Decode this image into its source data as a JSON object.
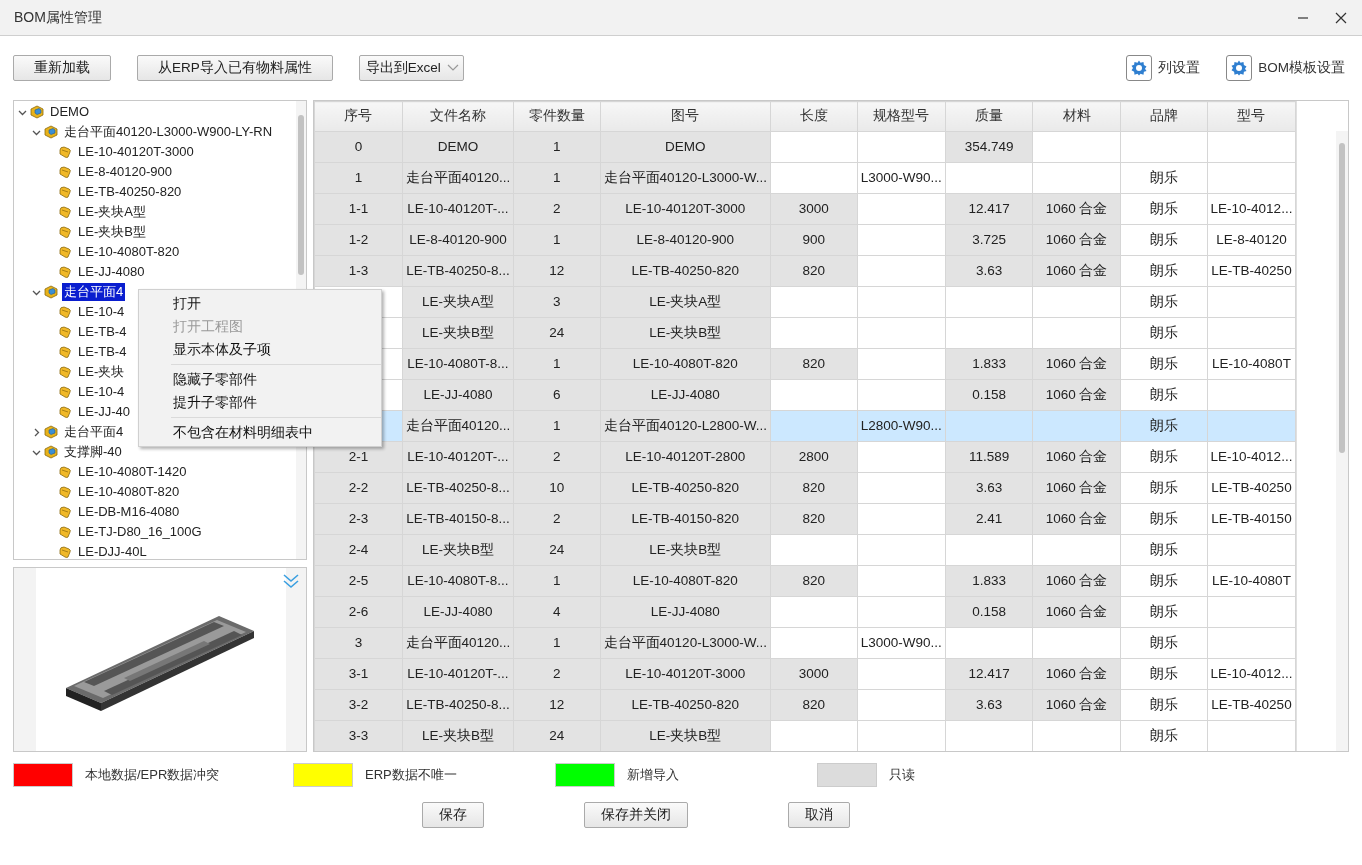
{
  "window": {
    "title": "BOM属性管理"
  },
  "toolbar": {
    "buttons": [
      "重新加载",
      "从ERP导入已有物料属性"
    ],
    "export_dropdown": "导出到Excel",
    "settings": [
      "列设置",
      "BOM模板设置"
    ]
  },
  "tree": [
    {
      "label": "DEMO",
      "kind": "assembly",
      "expanded": true,
      "selected": false,
      "children": [
        {
          "label": "走台平面40120-L3000-W900-LY-RN",
          "kind": "assembly",
          "expanded": true,
          "selected": false,
          "children": [
            {
              "label": "LE-10-40120T-3000",
              "kind": "part",
              "selected": false
            },
            {
              "label": "LE-8-40120-900",
              "kind": "part",
              "selected": false
            },
            {
              "label": "LE-TB-40250-820",
              "kind": "part",
              "selected": false
            },
            {
              "label": "LE-夹块A型",
              "kind": "part",
              "selected": false
            },
            {
              "label": "LE-夹块B型",
              "kind": "part",
              "selected": false
            },
            {
              "label": "LE-10-4080T-820",
              "kind": "part",
              "selected": false
            },
            {
              "label": "LE-JJ-4080",
              "kind": "part",
              "selected": false
            }
          ]
        },
        {
          "label": "走台平面4",
          "kind": "assembly",
          "expanded": true,
          "selected": true,
          "children": [
            {
              "label": "LE-10-4",
              "kind": "part",
              "selected": false
            },
            {
              "label": "LE-TB-4",
              "kind": "part",
              "selected": false
            },
            {
              "label": "LE-TB-4",
              "kind": "part",
              "selected": false
            },
            {
              "label": "LE-夹块",
              "kind": "part",
              "selected": false
            },
            {
              "label": "LE-10-4",
              "kind": "part",
              "selected": false
            },
            {
              "label": "LE-JJ-40",
              "kind": "part",
              "selected": false
            }
          ]
        },
        {
          "label": "走台平面4",
          "kind": "assembly",
          "expanded": false,
          "selected": false
        },
        {
          "label": "支撑脚-40",
          "kind": "assembly",
          "expanded": true,
          "selected": false,
          "children": [
            {
              "label": "LE-10-4080T-1420",
              "kind": "part",
              "selected": false
            },
            {
              "label": "LE-10-4080T-820",
              "kind": "part",
              "selected": false
            },
            {
              "label": "LE-DB-M16-4080",
              "kind": "part",
              "selected": false
            },
            {
              "label": "LE-TJ-D80_16_100G",
              "kind": "part",
              "selected": false
            },
            {
              "label": "LE-DJJ-40L",
              "kind": "part",
              "selected": false
            }
          ]
        }
      ]
    }
  ],
  "context_menu": [
    {
      "kind": "item",
      "label": "打开",
      "disabled": false
    },
    {
      "kind": "item",
      "label": "打开工程图",
      "disabled": true
    },
    {
      "kind": "item",
      "label": "显示本体及子项",
      "disabled": false
    },
    {
      "kind": "separator"
    },
    {
      "kind": "item",
      "label": "隐藏子零部件",
      "disabled": false
    },
    {
      "kind": "item",
      "label": "提升子零部件",
      "disabled": false
    },
    {
      "kind": "separator"
    },
    {
      "kind": "item",
      "label": "不包含在材料明细表中",
      "disabled": false
    }
  ],
  "table": {
    "columns": [
      {
        "label": "序号",
        "readonly": true
      },
      {
        "label": "文件名称",
        "readonly": true
      },
      {
        "label": "零件数量",
        "readonly": true
      },
      {
        "label": "图号",
        "readonly": true
      },
      {
        "label": "长度",
        "readonly": true
      },
      {
        "label": "规格型号",
        "readonly": false
      },
      {
        "label": "质量",
        "readonly": true
      },
      {
        "label": "材料",
        "readonly": true
      },
      {
        "label": "品牌",
        "readonly": false
      },
      {
        "label": "型号",
        "readonly": false
      }
    ],
    "rows": [
      {
        "selected": false,
        "cells": [
          "0",
          "DEMO",
          "1",
          "DEMO",
          null,
          null,
          "354.749",
          null,
          null,
          null
        ]
      },
      {
        "selected": false,
        "cells": [
          "1",
          "走台平面40120...",
          "1",
          "走台平面40120-L3000-W...",
          null,
          "L3000-W90...",
          null,
          null,
          "朗乐",
          null
        ]
      },
      {
        "selected": false,
        "cells": [
          "1-1",
          "LE-10-40120T-...",
          "2",
          "LE-10-40120T-3000",
          "3000",
          null,
          "12.417",
          "1060 合金",
          "朗乐",
          "LE-10-4012..."
        ]
      },
      {
        "selected": false,
        "cells": [
          "1-2",
          "LE-8-40120-900",
          "1",
          "LE-8-40120-900",
          "900",
          null,
          "3.725",
          "1060 合金",
          "朗乐",
          "LE-8-40120"
        ]
      },
      {
        "selected": false,
        "cells": [
          "1-3",
          "LE-TB-40250-8...",
          "12",
          "LE-TB-40250-820",
          "820",
          null,
          "3.63",
          "1060 合金",
          "朗乐",
          "LE-TB-40250"
        ]
      },
      {
        "selected": false,
        "cells": [
          null,
          "LE-夹块A型",
          "3",
          "LE-夹块A型",
          null,
          null,
          null,
          null,
          "朗乐",
          null
        ]
      },
      {
        "selected": false,
        "cells": [
          null,
          "LE-夹块B型",
          "24",
          "LE-夹块B型",
          null,
          null,
          null,
          null,
          "朗乐",
          null
        ]
      },
      {
        "selected": false,
        "cells": [
          null,
          "LE-10-4080T-8...",
          "1",
          "LE-10-4080T-820",
          "820",
          null,
          "1.833",
          "1060 合金",
          "朗乐",
          "LE-10-4080T"
        ]
      },
      {
        "selected": false,
        "cells": [
          null,
          "LE-JJ-4080",
          "6",
          "LE-JJ-4080",
          null,
          null,
          "0.158",
          "1060 合金",
          "朗乐",
          null
        ]
      },
      {
        "selected": true,
        "cells": [
          null,
          "走台平面40120...",
          "1",
          "走台平面40120-L2800-W...",
          null,
          "L2800-W90...",
          null,
          null,
          "朗乐",
          null
        ]
      },
      {
        "selected": false,
        "cells": [
          "2-1",
          "LE-10-40120T-...",
          "2",
          "LE-10-40120T-2800",
          "2800",
          null,
          "11.589",
          "1060 合金",
          "朗乐",
          "LE-10-4012..."
        ]
      },
      {
        "selected": false,
        "cells": [
          "2-2",
          "LE-TB-40250-8...",
          "10",
          "LE-TB-40250-820",
          "820",
          null,
          "3.63",
          "1060 合金",
          "朗乐",
          "LE-TB-40250"
        ]
      },
      {
        "selected": false,
        "cells": [
          "2-3",
          "LE-TB-40150-8...",
          "2",
          "LE-TB-40150-820",
          "820",
          null,
          "2.41",
          "1060 合金",
          "朗乐",
          "LE-TB-40150"
        ]
      },
      {
        "selected": false,
        "cells": [
          "2-4",
          "LE-夹块B型",
          "24",
          "LE-夹块B型",
          null,
          null,
          null,
          null,
          "朗乐",
          null
        ]
      },
      {
        "selected": false,
        "cells": [
          "2-5",
          "LE-10-4080T-8...",
          "1",
          "LE-10-4080T-820",
          "820",
          null,
          "1.833",
          "1060 合金",
          "朗乐",
          "LE-10-4080T"
        ]
      },
      {
        "selected": false,
        "cells": [
          "2-6",
          "LE-JJ-4080",
          "4",
          "LE-JJ-4080",
          null,
          null,
          "0.158",
          "1060 合金",
          "朗乐",
          null
        ]
      },
      {
        "selected": false,
        "cells": [
          "3",
          "走台平面40120...",
          "1",
          "走台平面40120-L3000-W...",
          null,
          "L3000-W90...",
          null,
          null,
          "朗乐",
          null
        ]
      },
      {
        "selected": false,
        "cells": [
          "3-1",
          "LE-10-40120T-...",
          "2",
          "LE-10-40120T-3000",
          "3000",
          null,
          "12.417",
          "1060 合金",
          "朗乐",
          "LE-10-4012..."
        ]
      },
      {
        "selected": false,
        "cells": [
          "3-2",
          "LE-TB-40250-8...",
          "12",
          "LE-TB-40250-820",
          "820",
          null,
          "3.63",
          "1060 合金",
          "朗乐",
          "LE-TB-40250"
        ]
      },
      {
        "selected": false,
        "cells": [
          "3-3",
          "LE-夹块B型",
          "24",
          "LE-夹块B型",
          null,
          null,
          null,
          null,
          "朗乐",
          null
        ]
      }
    ]
  },
  "legend": [
    {
      "label": "本地数据/EPR数据冲突",
      "color": "#ff0000"
    },
    {
      "label": "ERP数据不唯一",
      "color": "#ffff00"
    },
    {
      "label": "新增导入",
      "color": "#00ff00"
    },
    {
      "label": "只读",
      "color": "#dcdcdc"
    }
  ],
  "footer_buttons": [
    "保存",
    "保存并关闭",
    "取消"
  ]
}
